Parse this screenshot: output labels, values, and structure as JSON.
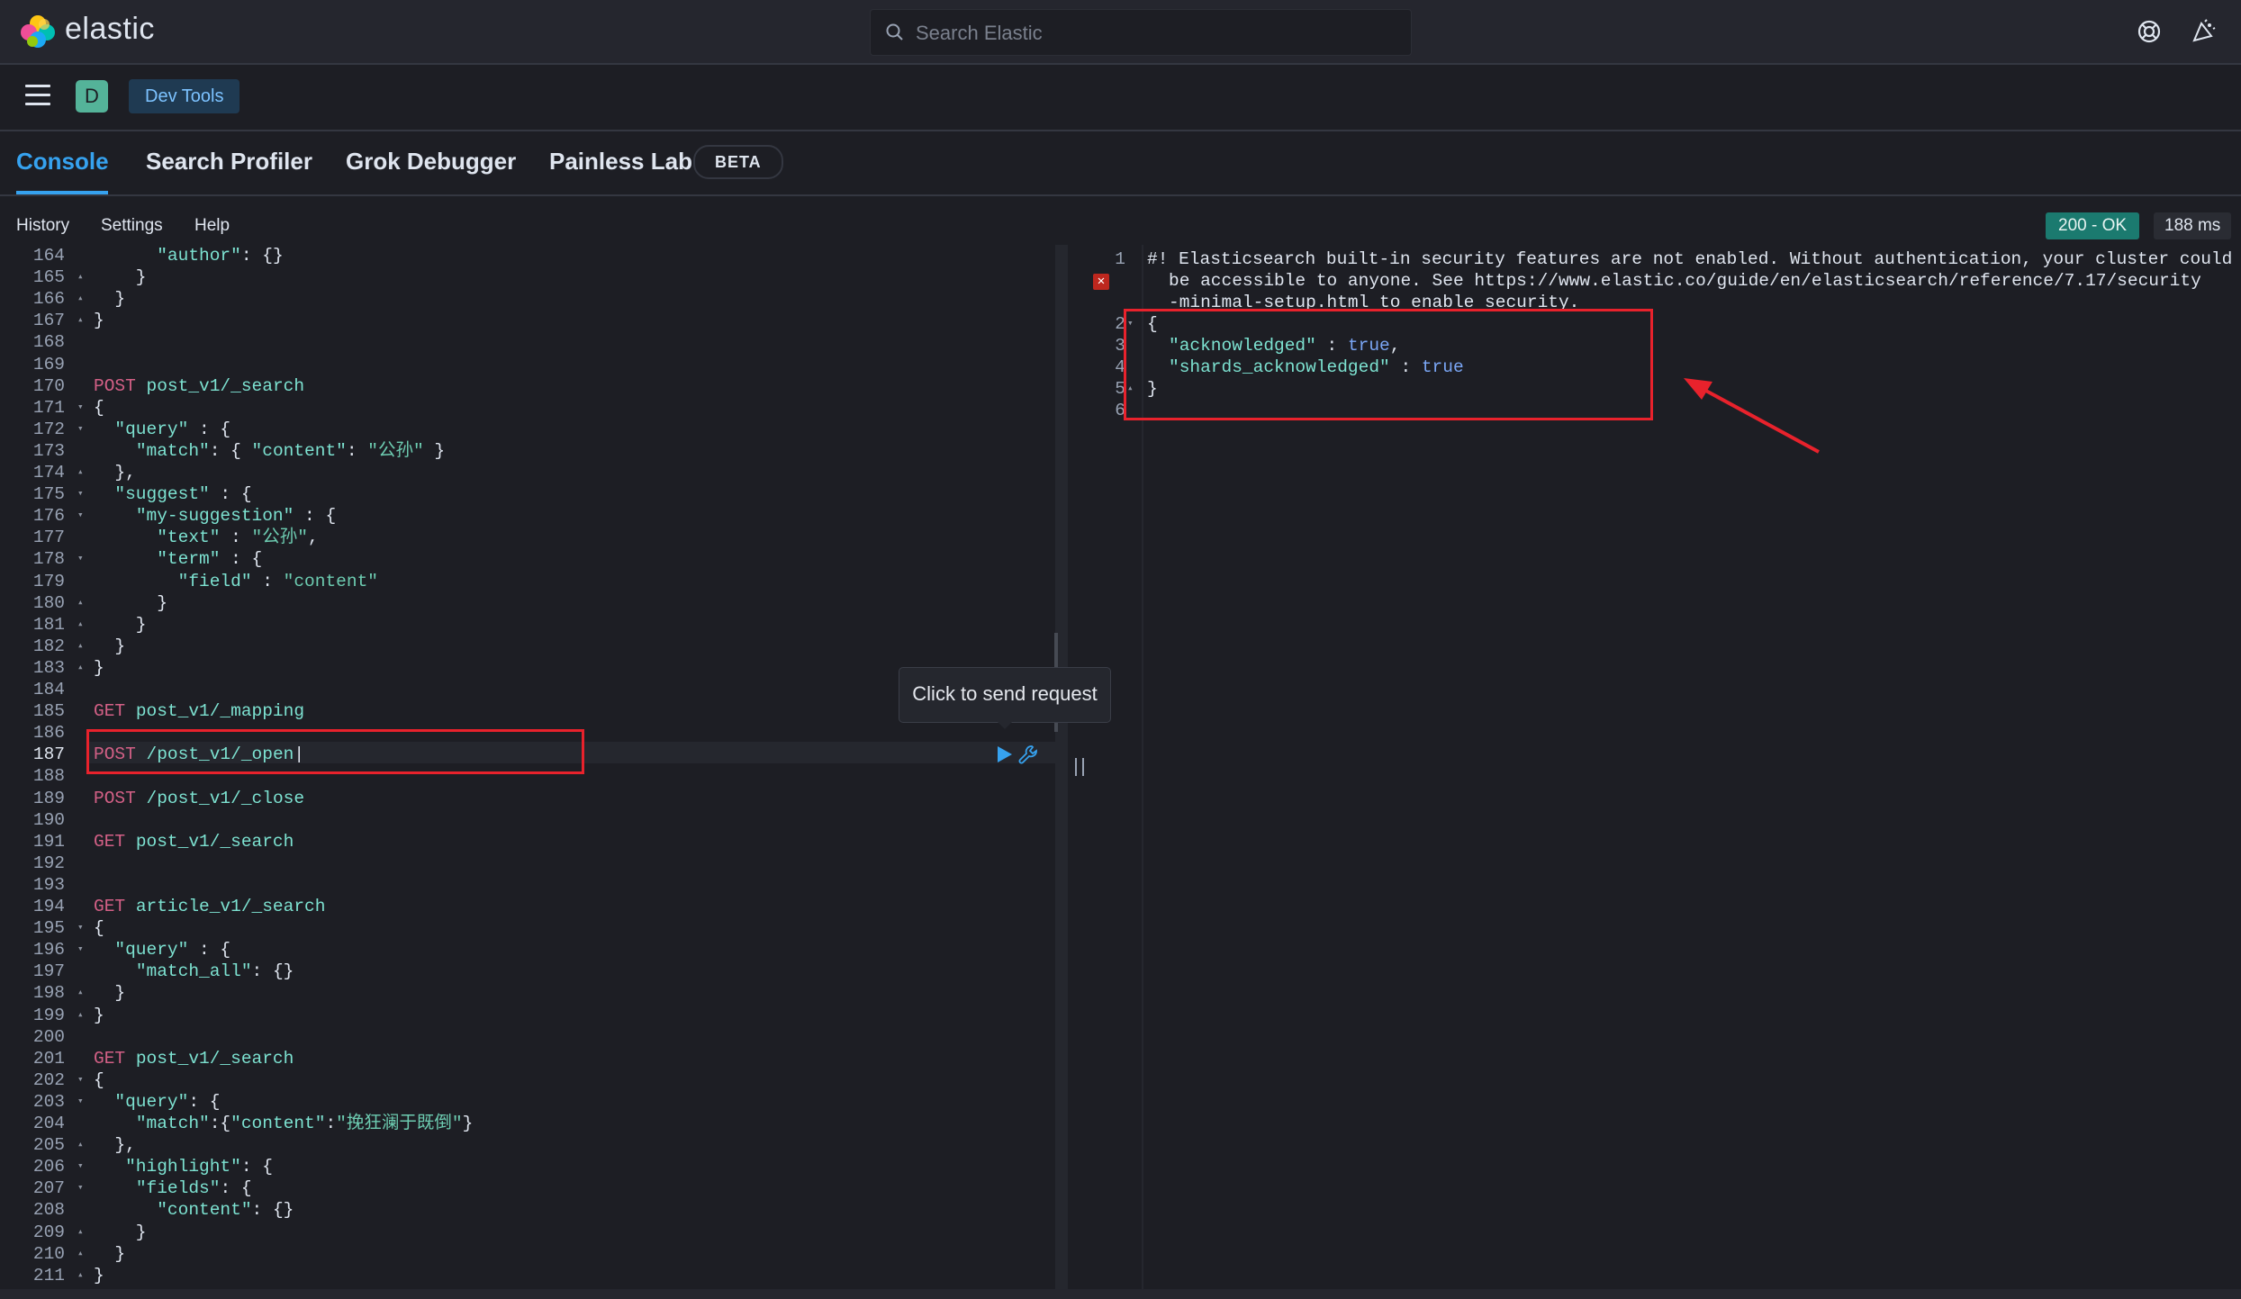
{
  "header": {
    "brand": "elastic",
    "search_placeholder": "Search Elastic"
  },
  "nav": {
    "space_initial": "D",
    "breadcrumb": "Dev Tools"
  },
  "tabs": [
    {
      "label": "Console"
    },
    {
      "label": "Search Profiler"
    },
    {
      "label": "Grok Debugger"
    },
    {
      "label": "Painless Lab"
    }
  ],
  "beta_label": "BETA",
  "toolbar": {
    "history": "History",
    "settings": "Settings",
    "help": "Help",
    "status": "200 - OK",
    "time": "188 ms"
  },
  "tooltip": "Click to send request",
  "left_editor": {
    "line_numbers": [
      "164",
      "165",
      "166",
      "167",
      "168",
      "169",
      "170",
      "171",
      "172",
      "173",
      "174",
      "175",
      "176",
      "177",
      "178",
      "179",
      "180",
      "181",
      "182",
      "183",
      "184",
      "185",
      "186",
      "187",
      "188",
      "189",
      "190",
      "191",
      "192",
      "193",
      "194",
      "195",
      "196",
      "197",
      "198",
      "199",
      "200",
      "201",
      "202",
      "203",
      "204",
      "205",
      "206",
      "207",
      "208",
      "209",
      "210",
      "211"
    ],
    "active_line": "187"
  },
  "right_editor": {
    "line_numbers": [
      "1",
      "2",
      "3",
      "4",
      "5",
      "6"
    ],
    "warning_line1": "#! Elasticsearch built-in security features are not enabled. Without authentication, your cluster could",
    "warning_line2": "be accessible to anyone. See https://www.elastic.co/guide/en/elasticsearch/reference/7.17/security",
    "warning_line3": "-minimal-setup.html to enable security.",
    "response_key1": "\"acknowledged\"",
    "response_val1": "true",
    "response_key2": "\"shards_acknowledged\"",
    "response_val2": "true"
  }
}
